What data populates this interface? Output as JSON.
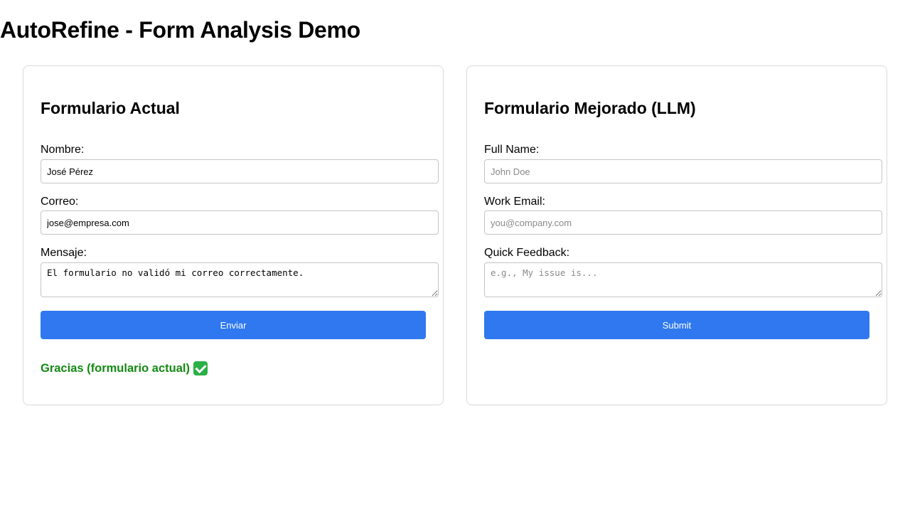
{
  "page": {
    "title": "AutoRefine - Form Analysis Demo"
  },
  "current_form": {
    "title": "Formulario Actual",
    "name_label": "Nombre:",
    "name_value": "José Pérez",
    "email_label": "Correo:",
    "email_value": "jose@empresa.com",
    "message_label": "Mensaje:",
    "message_value": "El formulario no validó mi correo correctamente.",
    "submit_label": "Enviar",
    "success_text": "Gracias (formulario actual)",
    "success_icon": "check-mark-icon"
  },
  "improved_form": {
    "title": "Formulario Mejorado (LLM)",
    "name_label": "Full Name:",
    "name_placeholder": "John Doe",
    "email_label": "Work Email:",
    "email_placeholder": "you@company.com",
    "feedback_label": "Quick Feedback:",
    "feedback_placeholder": "e.g., My issue is...",
    "submit_label": "Submit"
  },
  "colors": {
    "button_bg": "#2f78ef",
    "success_text": "#138a13",
    "card_border": "#d9d9d9"
  }
}
